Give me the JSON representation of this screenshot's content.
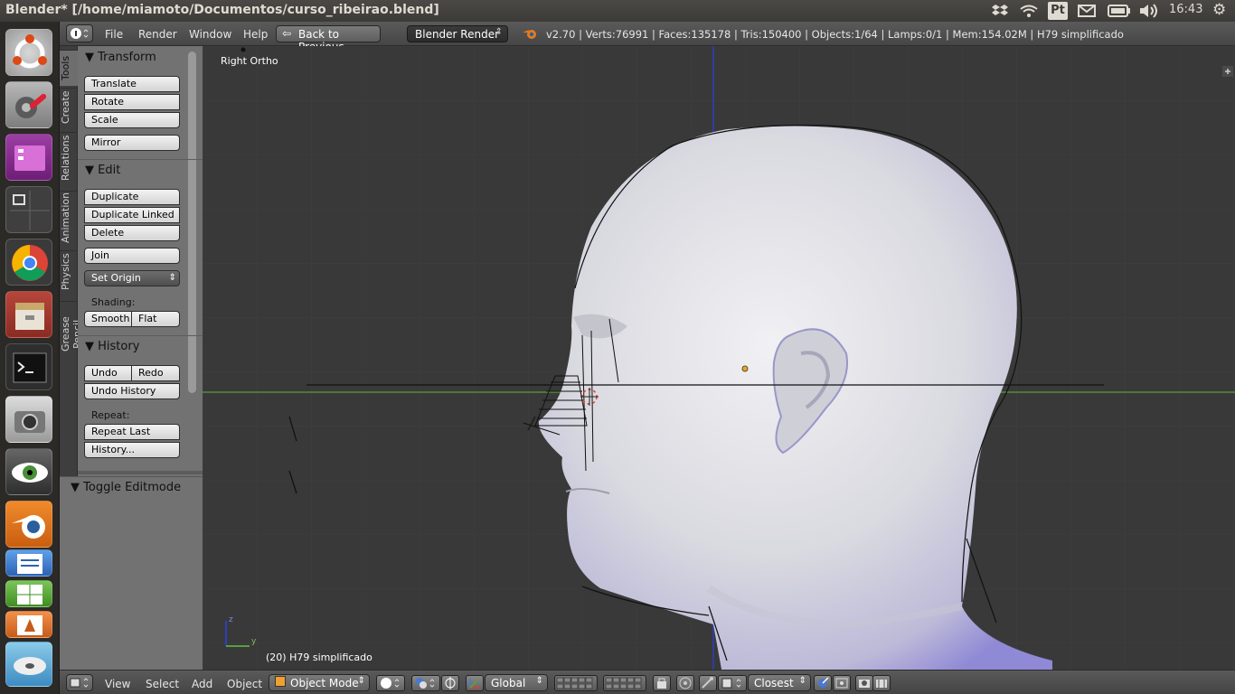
{
  "top_panel": {
    "window_title": "Blender* [/home/miamoto/Documentos/curso_ribeirao.blend]",
    "keyboard_layout": "Pt",
    "clock": "16:43",
    "icons": [
      "dropbox-icon",
      "wifi-icon",
      "keyboard-icon",
      "mail-icon",
      "battery-icon",
      "volume-icon",
      "gear-icon"
    ]
  },
  "launcher": {
    "items": [
      "ubuntu-dash",
      "system-settings",
      "workspace",
      "window-switcher",
      "chrome",
      "files",
      "terminal",
      "camera",
      "eye-of-gnome",
      "blender",
      "libreoffice-writer",
      "libreoffice-calc",
      "libreoffice-impress",
      "disk"
    ]
  },
  "header": {
    "menus": [
      "File",
      "Render",
      "Window",
      "Help"
    ],
    "back_button": "Back to Previous",
    "render_engine": "Blender Render",
    "stats": "v2.70 | Verts:76991 | Faces:135178 | Tris:150400 | Objects:1/64 | Lamps:0/1 | Mem:154.02M | H79 simplificado"
  },
  "tabs": [
    "Tools",
    "Create",
    "Relations",
    "Animation",
    "Physics",
    "Grease Pencil"
  ],
  "toolshelf": {
    "transform": {
      "title": "Transform",
      "buttons": [
        "Translate",
        "Rotate",
        "Scale",
        "Mirror"
      ]
    },
    "edit": {
      "title": "Edit",
      "buttons": [
        "Duplicate",
        "Duplicate Linked",
        "Delete",
        "Join"
      ],
      "set_origin": "Set Origin",
      "shading_label": "Shading:",
      "smooth": "Smooth",
      "flat": "Flat"
    },
    "history": {
      "title": "History",
      "undo": "Undo",
      "redo": "Redo",
      "undo_history": "Undo History",
      "repeat_label": "Repeat:",
      "repeat_last": "Repeat Last",
      "history_dots": "History..."
    },
    "toggle_editmode": "Toggle Editmode"
  },
  "viewport": {
    "view_name": "Right Ortho",
    "object_info": "(20) H79 simplificado",
    "axis_z": "z",
    "axis_y": "y"
  },
  "bottom": {
    "menus": [
      "View",
      "Select",
      "Add",
      "Object"
    ],
    "mode": "Object Mode",
    "orientation": "Global",
    "snap": "Closest"
  },
  "colors": {
    "panel_bg": "#727272",
    "viewport_bg": "#393939",
    "header_bg": "#4f4f4f",
    "axis_green": "#5a9e3c",
    "axis_blue": "#2e3fbf",
    "launcher_bg": "#2b2a27"
  }
}
